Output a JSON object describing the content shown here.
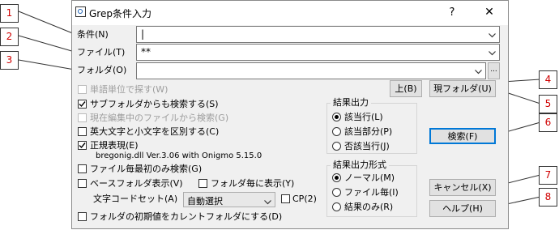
{
  "window": {
    "title": "Grep条件入力",
    "help_glyph": "?",
    "close_glyph": "✕"
  },
  "fields": {
    "condition_label": "条件(N)",
    "condition_value": "|",
    "file_label": "ファイル(T)",
    "file_value": "**",
    "folder_label": "フォルダ(O)",
    "folder_value": "",
    "browse_label": "..."
  },
  "buttons": {
    "up": "上(B)",
    "current_folder": "現フォルダ(U)",
    "search": "検索(F)",
    "cancel": "キャンセル(X)",
    "help": "ヘルプ(H)"
  },
  "options": {
    "word_unit": "単語単位で探す(W)",
    "search_subfolders": "サブフォルダからも検索する(S)",
    "search_editing_files": "現在編集中のファイルから検索(G)",
    "case_sensitive": "英大文字と小文字を区別する(C)",
    "regex": "正規表現(E)",
    "regex_info": "bregonig.dll Ver.3.06 with Onigmo 5.15.0",
    "first_match_only": "ファイル毎最初のみ検索(G)",
    "base_folder_display": "ベースフォルダ表示(V)",
    "per_folder_display": "フォルダ毎に表示(Y)",
    "charset_label": "文字コードセット(A)",
    "charset_value": "自動選択",
    "cp_label": "CP(2)",
    "initial_folder_current": "フォルダの初期値をカレントフォルダにする(D)"
  },
  "result_output": {
    "title": "結果出力",
    "items": [
      "該当行(L)",
      "該当部分(P)",
      "否該当行(J)"
    ],
    "selected": 0
  },
  "result_format": {
    "title": "結果出力形式",
    "items": [
      "ノーマル(M)",
      "ファイル毎(I)",
      "結果のみ(R)"
    ],
    "selected": 0
  },
  "callouts": [
    "1",
    "2",
    "3",
    "4",
    "5",
    "6",
    "7",
    "8"
  ],
  "colors": {
    "callout_text": "#d00000",
    "default_button_border": "#0078d7",
    "dialog_bg": "#f0f0f0"
  }
}
